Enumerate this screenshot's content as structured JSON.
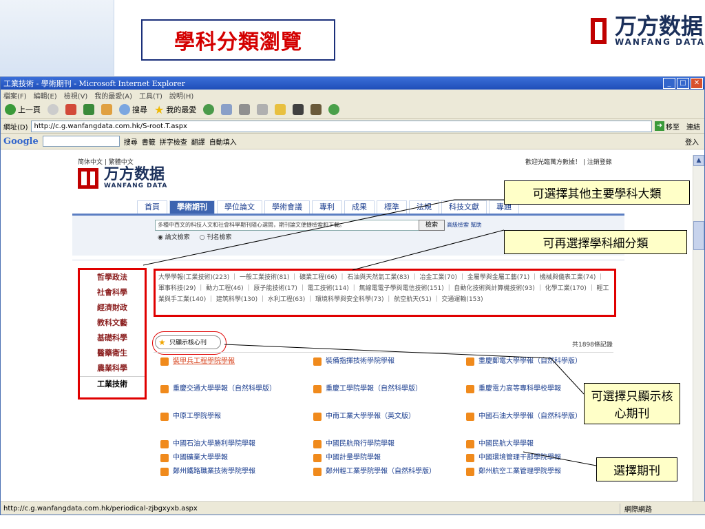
{
  "slide": {
    "title": "學科分類瀏覽",
    "logo_cn": "万方数据",
    "logo_en": "WANFANG DATA"
  },
  "browser": {
    "title": "工業技術 - 學術期刊 - Microsoft Internet Explorer",
    "menu": [
      "檔案(F)",
      "編輯(E)",
      "檢視(V)",
      "我的最愛(A)",
      "工具(T)",
      "說明(H)"
    ],
    "toolbar": {
      "back": "上一頁",
      "search": "搜尋",
      "favorites": "我的最愛"
    },
    "address_label": "網址(D)",
    "address_value": "http://c.g.wanfangdata.com.hk/S-root.T.aspx",
    "go": "移至",
    "links": "連結",
    "google_label": "Google",
    "google_items": [
      "搜尋",
      "書籤",
      "拼字檢查",
      "翻譯",
      "自動填入"
    ],
    "google_login": "登入",
    "status_url": "http://c.g.wanfangdata.com.hk/periodical-zjbgxyxb.aspx",
    "status_zone": "網際網路"
  },
  "site": {
    "lang": "简体中文 | 繁體中文",
    "welcome": "歡迎光臨萬方數據！ | 注銷登錄",
    "logo_cn": "万方数据",
    "logo_en": "WANFANG DATA",
    "tabs": [
      "首頁",
      "學術期刊",
      "學位論文",
      "學術會議",
      "專利",
      "成果",
      "標準",
      "法規",
      "科技文獻",
      "專題"
    ],
    "active_tab_index": 1,
    "search_placeholder": "多種中西文的科技人文和社會科學期刊隨心選閱，期刊論文便捷檢索和下載。",
    "search_button": "檢索",
    "advanced": "高級檢索 幫助",
    "radio1": "論文檢索",
    "radio2": "刊名檢索",
    "categories": [
      "哲學政法",
      "社會科學",
      "經濟財政",
      "教科文藝",
      "基礎科學",
      "醫藥衛生",
      "農業科學",
      "工業技術"
    ],
    "active_category": "工業技術",
    "subjects": "大學學報(工業技術)(223) ｜ 一般工業技術(81) ｜ 礦業工程(66) ｜ 石油與天然氣工業(83) ｜ 冶金工業(70) ｜ 金屬學與金屬工藝(71) ｜ 機械與儀表工業(74) ｜ 軍事科技(29) ｜ 動力工程(46) ｜ 原子能技術(17) ｜ 電工技術(114) ｜ 無線電電子學與電信技術(151) ｜ 自動化技術與計算機技術(93) ｜ 化學工業(170) ｜ 輕工業與手工業(140) ｜ 建筑科學(130) ｜ 水利工程(63) ｜ 環境科學與安全科學(73) ｜ 航空航天(51) ｜ 交通運輸(153)",
    "core_button": "只顯示核心刊",
    "record_count": "共1898條記錄",
    "journals": [
      [
        "裝甲兵工程學院學報",
        "裝備指揮技術學院學報",
        "重慶郵電大學學報（自然科學版）"
      ],
      [
        "重慶交通大學學報（自然科學版）",
        "重慶工學院學報（自然科學版）",
        "重慶電力高等專科學校學報"
      ],
      [
        "中原工學院學報",
        "中南工業大學學報（英文版）",
        "中國石油大學學報（自然科學版）"
      ],
      [
        "中國石油大學勝利學院學報",
        "中國民航飛行學院學報",
        "中國民航大學學報"
      ],
      [
        "中國礦業大學學報",
        "中國計量學院學報",
        "中國環境管理干部學院學報"
      ],
      [
        "鄭州鐵路職業技術學院學報",
        "鄭州輕工業學院學報（自然科學版）",
        "鄭州航空工業管理學院學報"
      ]
    ]
  },
  "callouts": {
    "c1": "可選擇其他主要學科大類",
    "c2": "可再選擇學科細分類",
    "c3": "可選擇只顯示核心期刊",
    "c4": "選擇期刊"
  },
  "colors": {
    "accent_red": "#e00000",
    "brand_blue": "#1a2f5a",
    "tab_active": "#3d64b0"
  }
}
